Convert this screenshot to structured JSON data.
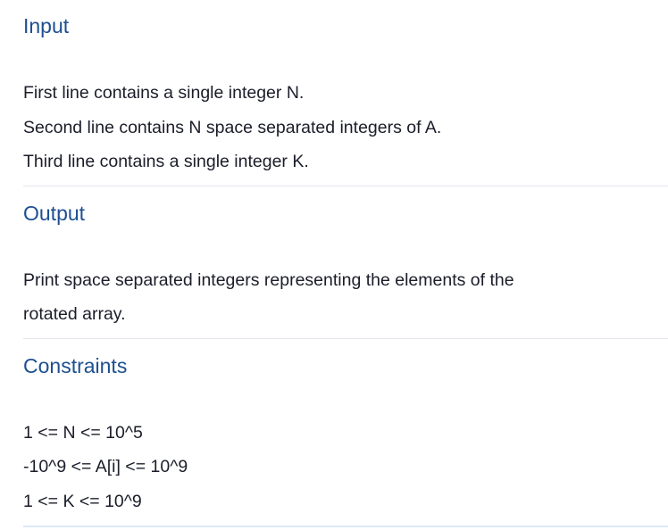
{
  "sections": [
    {
      "title": "Input",
      "lines": [
        "First line contains a single integer N.",
        "Second line contains N space separated integers of A.",
        "Third line contains a single integer K."
      ]
    },
    {
      "title": "Output",
      "lines": [
        "Print space separated integers representing the elements of the",
        "rotated array."
      ]
    },
    {
      "title": "Constraints",
      "lines": [
        "1 <= N <= 10^5",
        "-10^9 <= A[i] <= 10^9",
        "1 <= K <= 10^9"
      ]
    }
  ],
  "colors": {
    "heading": "#1d4f91",
    "text": "#1b1d2a",
    "divider": "#e3e6ee"
  }
}
